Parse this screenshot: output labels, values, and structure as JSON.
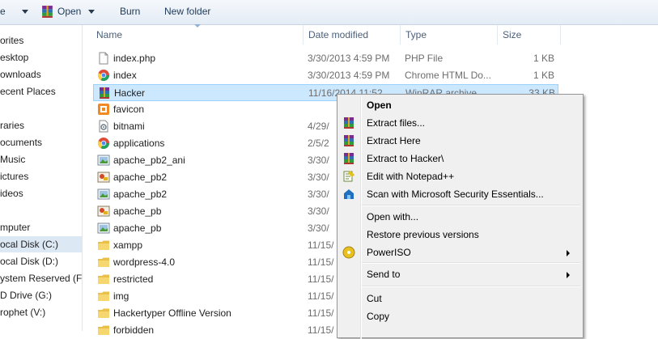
{
  "toolbar": {
    "organize_label": "e",
    "open_label": "Open",
    "burn_label": "Burn",
    "new_folder_label": "New folder"
  },
  "nav": [
    "orites",
    "esktop",
    "ownloads",
    "ecent Places",
    "raries",
    "ocuments",
    "Music",
    "ictures",
    "ideos",
    "mputer",
    "ocal Disk (C:)",
    "ocal Disk (D:)",
    "ystem Reserved (F:)",
    "D Drive (G:)",
    "rophet (V:)"
  ],
  "columns": {
    "name": "Name",
    "date": "Date modified",
    "type": "Type",
    "size": "Size"
  },
  "files": [
    {
      "name": "index.php",
      "date": "3/30/2013 4:59 PM",
      "type": "PHP File",
      "size": "1 KB",
      "icon": "php-file-icon"
    },
    {
      "name": "index",
      "date": "3/30/2013 4:59 PM",
      "type": "Chrome HTML Do...",
      "size": "1 KB",
      "icon": "chrome-icon"
    },
    {
      "name": "Hacker",
      "date": "11/16/2014 11:52",
      "type": "WinRAR archive",
      "size": "33 KB",
      "icon": "winrar-icon"
    },
    {
      "name": "favicon",
      "date": "",
      "type": "",
      "size": "",
      "icon": "favicon-icon"
    },
    {
      "name": "bitnami",
      "date": "4/29/",
      "type": "",
      "size": "",
      "icon": "settings-file-icon"
    },
    {
      "name": "applications",
      "date": "2/5/2",
      "type": "",
      "size": "",
      "icon": "chrome-icon"
    },
    {
      "name": "apache_pb2_ani",
      "date": "3/30/",
      "type": "",
      "size": "",
      "icon": "image-icon"
    },
    {
      "name": "apache_pb2",
      "date": "3/30/",
      "type": "",
      "size": "",
      "icon": "paint-image-icon"
    },
    {
      "name": "apache_pb2",
      "date": "3/30/",
      "type": "",
      "size": "",
      "icon": "image-icon"
    },
    {
      "name": "apache_pb",
      "date": "3/30/",
      "type": "",
      "size": "",
      "icon": "paint-image-icon"
    },
    {
      "name": "apache_pb",
      "date": "3/30/",
      "type": "",
      "size": "",
      "icon": "image-icon"
    },
    {
      "name": "xampp",
      "date": "11/15/",
      "type": "",
      "size": "",
      "icon": "folder-icon"
    },
    {
      "name": "wordpress-4.0",
      "date": "11/15/",
      "type": "",
      "size": "",
      "icon": "folder-icon"
    },
    {
      "name": "restricted",
      "date": "11/15/",
      "type": "",
      "size": "",
      "icon": "folder-icon"
    },
    {
      "name": "img",
      "date": "11/15/",
      "type": "",
      "size": "",
      "icon": "folder-icon"
    },
    {
      "name": "Hackertyper Offline Version",
      "date": "11/15/",
      "type": "",
      "size": "",
      "icon": "folder-icon"
    },
    {
      "name": "forbidden",
      "date": "11/15/",
      "type": "",
      "size": "",
      "icon": "folder-icon"
    }
  ],
  "context_menu": [
    {
      "label": "Open",
      "bold": true,
      "icon": ""
    },
    {
      "label": "Extract files...",
      "icon": "winrar-icon"
    },
    {
      "label": "Extract Here",
      "icon": "winrar-icon"
    },
    {
      "label": "Extract to Hacker\\",
      "icon": "winrar-icon"
    },
    {
      "label": "Edit with Notepad++",
      "icon": "notepad-plus-icon"
    },
    {
      "label": "Scan with Microsoft Security Essentials...",
      "icon": "security-essentials-icon"
    },
    {
      "label": "Open with...",
      "icon": ""
    },
    {
      "label": "Restore previous versions",
      "icon": ""
    },
    {
      "label": "PowerISO",
      "icon": "poweriso-icon",
      "submenu": true
    },
    {
      "label": "Send to",
      "icon": "",
      "submenu": true
    },
    {
      "label": "Cut",
      "icon": ""
    },
    {
      "label": "Copy",
      "icon": ""
    }
  ],
  "colors": {
    "selection": "#cce8ff",
    "selection_border": "#99d1ff",
    "menu_bg": "#f0f0f0"
  }
}
